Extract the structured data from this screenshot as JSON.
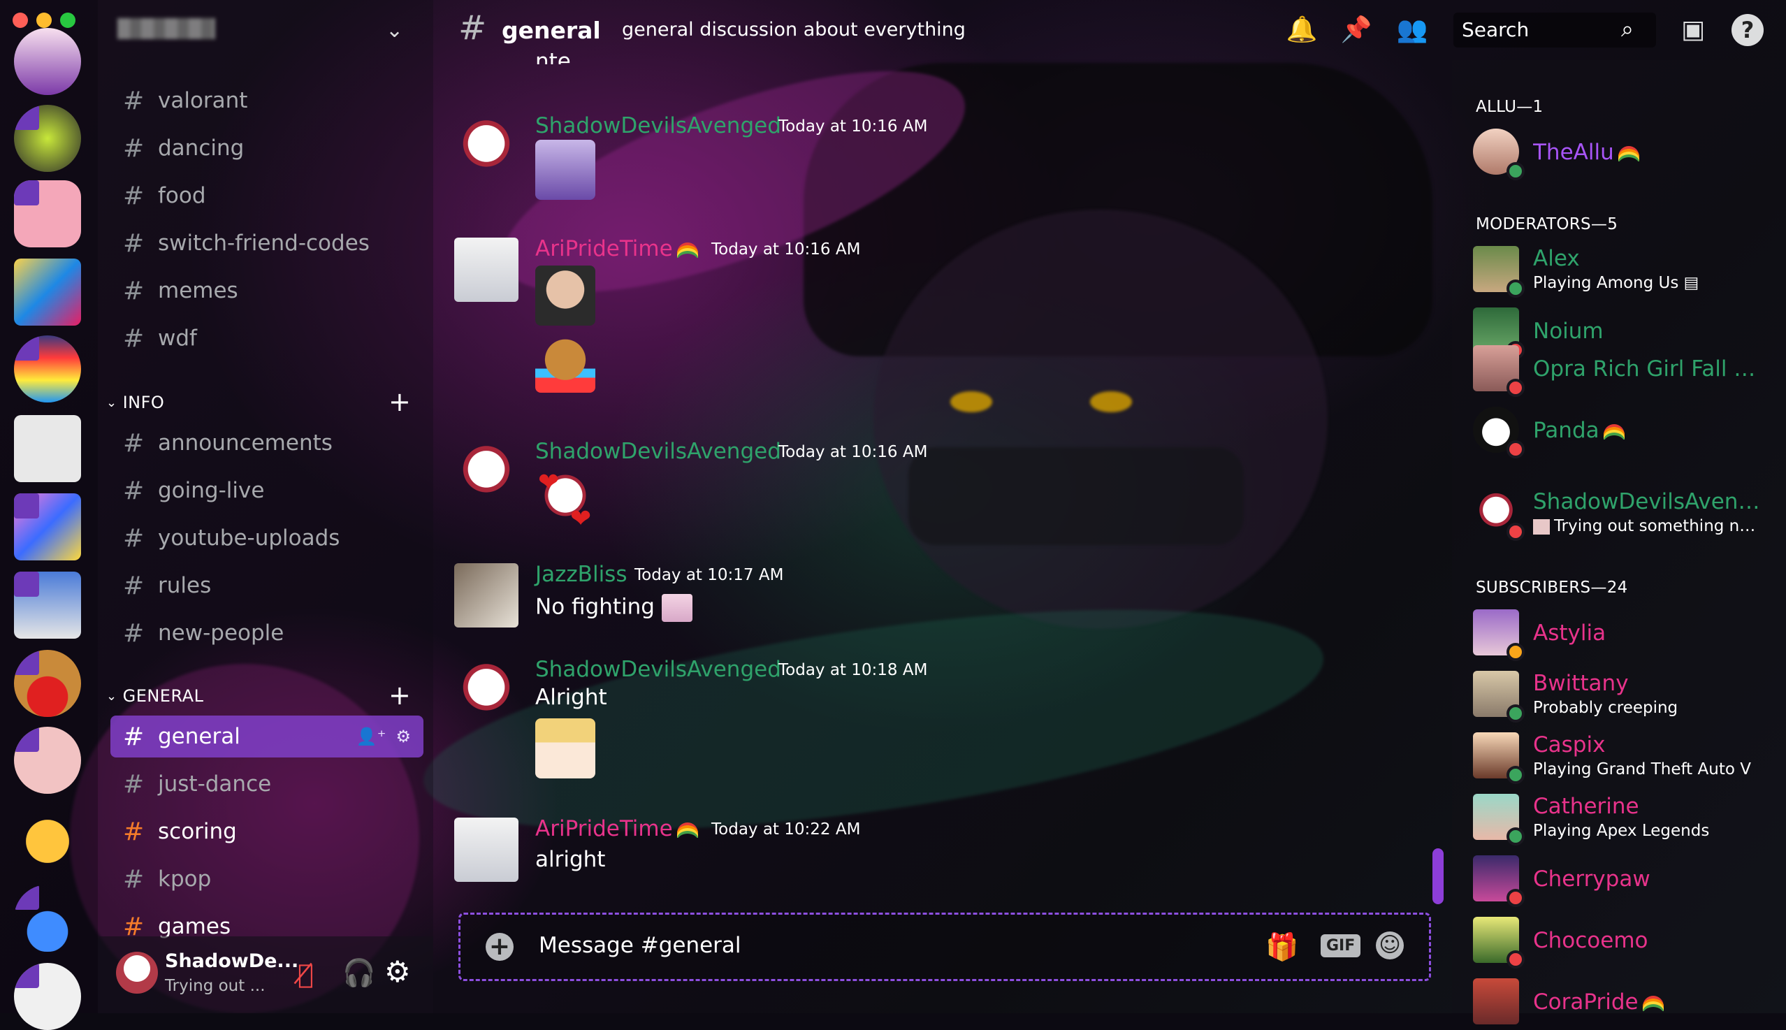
{
  "window": {
    "lights": [
      "#ff5f57",
      "#febc2e",
      "#28c840"
    ]
  },
  "server": {
    "name_blurred": ""
  },
  "channels_top": [
    {
      "label": "valorant"
    },
    {
      "label": "dancing"
    },
    {
      "label": "food"
    },
    {
      "label": "switch-friend-codes"
    },
    {
      "label": "memes"
    },
    {
      "label": "wdf"
    }
  ],
  "category_info": {
    "label": "INFO"
  },
  "channels_info": [
    {
      "label": "announcements"
    },
    {
      "label": "going-live"
    },
    {
      "label": "youtube-uploads"
    },
    {
      "label": "rules"
    },
    {
      "label": "new-people"
    }
  ],
  "category_general": {
    "label": "GENERAL"
  },
  "channels_general": [
    {
      "label": "general"
    },
    {
      "label": "just-dance"
    },
    {
      "label": "scoring"
    },
    {
      "label": "kpop"
    },
    {
      "label": "games"
    }
  ],
  "user_panel": {
    "name": "ShadowDe...",
    "status": "Trying out ..."
  },
  "header": {
    "channel": "general",
    "topic": "general discussion about everything",
    "search_placeholder": "Search"
  },
  "messages": [
    {
      "author": "ShadowDevilsAvenged",
      "time": "Today at 10:16 AM",
      "text": ""
    },
    {
      "author": "AriPrideTime",
      "time": "Today at 10:16 AM",
      "text": ""
    },
    {
      "author": "ShadowDevilsAvenged",
      "time": "Today at 10:16 AM",
      "text": ""
    },
    {
      "author": "JazzBliss",
      "time": "Today at 10:17 AM",
      "text": "No fighting"
    },
    {
      "author": "ShadowDevilsAvenged",
      "time": "Today at 10:18 AM",
      "text": "Alright"
    },
    {
      "author": "AriPrideTime",
      "time": "Today at 10:22 AM",
      "text": "alright"
    }
  ],
  "composer": {
    "placeholder": "Message #general",
    "gif_label": "GIF"
  },
  "members": {
    "sections": [
      {
        "label": "ALLU—1"
      },
      {
        "label": "MODERATORS—5"
      },
      {
        "label": "SUBSCRIBERS—24"
      }
    ],
    "allu": [
      {
        "name": "TheAllu",
        "color": "#a855f7",
        "status": ""
      }
    ],
    "moderators": [
      {
        "name": "Alex",
        "color": "#2fa36b",
        "status": "Playing Among Us"
      },
      {
        "name": "Noium",
        "color": "#2fa36b",
        "status": ""
      },
      {
        "name": "Opra Rich Girl Fall Ve...",
        "color": "#2fa36b",
        "status": ""
      },
      {
        "name": "Panda",
        "color": "#2fa36b",
        "status": ""
      },
      {
        "name": "ShadowDevilsAveng...",
        "color": "#2fa36b",
        "status": "Trying out something ne..."
      }
    ],
    "subscribers": [
      {
        "name": "Astylia",
        "color": "#e8338b",
        "status": ""
      },
      {
        "name": "Bwittany",
        "color": "#e8338b",
        "status": "Probably creeping"
      },
      {
        "name": "Caspix",
        "color": "#e8338b",
        "status": "Playing Grand Theft Auto V"
      },
      {
        "name": "Catherine",
        "color": "#e8338b",
        "status": "Playing Apex Legends"
      },
      {
        "name": "Cherrypaw",
        "color": "#e8338b",
        "status": ""
      },
      {
        "name": "Chocoemo",
        "color": "#e8338b",
        "status": ""
      },
      {
        "name": "CoraPride",
        "color": "#e8338b",
        "status": ""
      }
    ]
  },
  "colors": {
    "green_name": "#2fa36b",
    "pink_name": "#e8338b",
    "purple_name": "#a855f7",
    "accent": "#8d3ed8"
  }
}
